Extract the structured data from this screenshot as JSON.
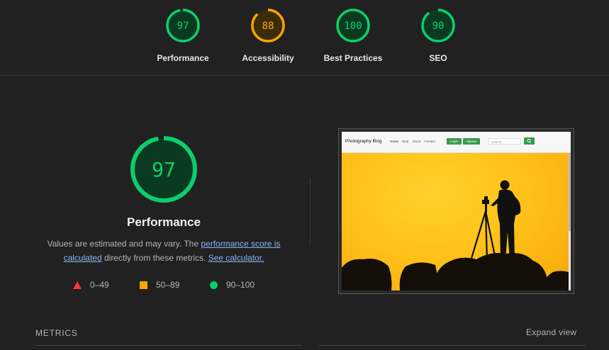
{
  "gauges": [
    {
      "label": "Performance",
      "score": "97",
      "value": 97,
      "color": "#0cce6b",
      "bg": "#0a3b22"
    },
    {
      "label": "Accessibility",
      "score": "88",
      "value": 88,
      "color": "#ffa400",
      "bg": "#3b2c0a"
    },
    {
      "label": "Best Practices",
      "score": "100",
      "value": 100,
      "color": "#0cce6b",
      "bg": "#0a3b22"
    },
    {
      "label": "SEO",
      "score": "90",
      "value": 90,
      "color": "#0cce6b",
      "bg": "#0a3b22"
    }
  ],
  "main": {
    "score": "97",
    "value": 97,
    "title": "Performance",
    "desc_prefix": "Values are estimated and may vary. The ",
    "desc_link1": "performance score is calculated",
    "desc_mid": " directly from these metrics. ",
    "desc_link2": "See calculator."
  },
  "legend": {
    "fail": "0–49",
    "average": "50–89",
    "pass": "90–100"
  },
  "thumbnail": {
    "brand": "Photography Blog",
    "links": [
      "Home",
      "Blog",
      "About",
      "Contact"
    ],
    "login": "Login",
    "signup": "Signup",
    "search_placeholder": "Search"
  },
  "metrics": {
    "heading": "METRICS",
    "expand": "Expand view"
  },
  "colors": {
    "pass": "#0cce6b",
    "average": "#ffa400",
    "fail": "#ff3333",
    "link": "#8ab4f8"
  }
}
